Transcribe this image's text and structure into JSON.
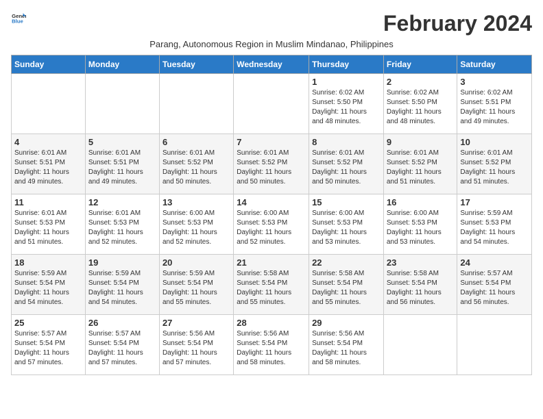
{
  "logo": {
    "text_general": "General",
    "text_blue": "Blue"
  },
  "title": "February 2024",
  "subtitle": "Parang, Autonomous Region in Muslim Mindanao, Philippines",
  "days_of_week": [
    "Sunday",
    "Monday",
    "Tuesday",
    "Wednesday",
    "Thursday",
    "Friday",
    "Saturday"
  ],
  "weeks": [
    [
      {
        "day": "",
        "info": ""
      },
      {
        "day": "",
        "info": ""
      },
      {
        "day": "",
        "info": ""
      },
      {
        "day": "",
        "info": ""
      },
      {
        "day": "1",
        "info": "Sunrise: 6:02 AM\nSunset: 5:50 PM\nDaylight: 11 hours\nand 48 minutes."
      },
      {
        "day": "2",
        "info": "Sunrise: 6:02 AM\nSunset: 5:50 PM\nDaylight: 11 hours\nand 48 minutes."
      },
      {
        "day": "3",
        "info": "Sunrise: 6:02 AM\nSunset: 5:51 PM\nDaylight: 11 hours\nand 49 minutes."
      }
    ],
    [
      {
        "day": "4",
        "info": "Sunrise: 6:01 AM\nSunset: 5:51 PM\nDaylight: 11 hours\nand 49 minutes."
      },
      {
        "day": "5",
        "info": "Sunrise: 6:01 AM\nSunset: 5:51 PM\nDaylight: 11 hours\nand 49 minutes."
      },
      {
        "day": "6",
        "info": "Sunrise: 6:01 AM\nSunset: 5:52 PM\nDaylight: 11 hours\nand 50 minutes."
      },
      {
        "day": "7",
        "info": "Sunrise: 6:01 AM\nSunset: 5:52 PM\nDaylight: 11 hours\nand 50 minutes."
      },
      {
        "day": "8",
        "info": "Sunrise: 6:01 AM\nSunset: 5:52 PM\nDaylight: 11 hours\nand 50 minutes."
      },
      {
        "day": "9",
        "info": "Sunrise: 6:01 AM\nSunset: 5:52 PM\nDaylight: 11 hours\nand 51 minutes."
      },
      {
        "day": "10",
        "info": "Sunrise: 6:01 AM\nSunset: 5:52 PM\nDaylight: 11 hours\nand 51 minutes."
      }
    ],
    [
      {
        "day": "11",
        "info": "Sunrise: 6:01 AM\nSunset: 5:53 PM\nDaylight: 11 hours\nand 51 minutes."
      },
      {
        "day": "12",
        "info": "Sunrise: 6:01 AM\nSunset: 5:53 PM\nDaylight: 11 hours\nand 52 minutes."
      },
      {
        "day": "13",
        "info": "Sunrise: 6:00 AM\nSunset: 5:53 PM\nDaylight: 11 hours\nand 52 minutes."
      },
      {
        "day": "14",
        "info": "Sunrise: 6:00 AM\nSunset: 5:53 PM\nDaylight: 11 hours\nand 52 minutes."
      },
      {
        "day": "15",
        "info": "Sunrise: 6:00 AM\nSunset: 5:53 PM\nDaylight: 11 hours\nand 53 minutes."
      },
      {
        "day": "16",
        "info": "Sunrise: 6:00 AM\nSunset: 5:53 PM\nDaylight: 11 hours\nand 53 minutes."
      },
      {
        "day": "17",
        "info": "Sunrise: 5:59 AM\nSunset: 5:53 PM\nDaylight: 11 hours\nand 54 minutes."
      }
    ],
    [
      {
        "day": "18",
        "info": "Sunrise: 5:59 AM\nSunset: 5:54 PM\nDaylight: 11 hours\nand 54 minutes."
      },
      {
        "day": "19",
        "info": "Sunrise: 5:59 AM\nSunset: 5:54 PM\nDaylight: 11 hours\nand 54 minutes."
      },
      {
        "day": "20",
        "info": "Sunrise: 5:59 AM\nSunset: 5:54 PM\nDaylight: 11 hours\nand 55 minutes."
      },
      {
        "day": "21",
        "info": "Sunrise: 5:58 AM\nSunset: 5:54 PM\nDaylight: 11 hours\nand 55 minutes."
      },
      {
        "day": "22",
        "info": "Sunrise: 5:58 AM\nSunset: 5:54 PM\nDaylight: 11 hours\nand 55 minutes."
      },
      {
        "day": "23",
        "info": "Sunrise: 5:58 AM\nSunset: 5:54 PM\nDaylight: 11 hours\nand 56 minutes."
      },
      {
        "day": "24",
        "info": "Sunrise: 5:57 AM\nSunset: 5:54 PM\nDaylight: 11 hours\nand 56 minutes."
      }
    ],
    [
      {
        "day": "25",
        "info": "Sunrise: 5:57 AM\nSunset: 5:54 PM\nDaylight: 11 hours\nand 57 minutes."
      },
      {
        "day": "26",
        "info": "Sunrise: 5:57 AM\nSunset: 5:54 PM\nDaylight: 11 hours\nand 57 minutes."
      },
      {
        "day": "27",
        "info": "Sunrise: 5:56 AM\nSunset: 5:54 PM\nDaylight: 11 hours\nand 57 minutes."
      },
      {
        "day": "28",
        "info": "Sunrise: 5:56 AM\nSunset: 5:54 PM\nDaylight: 11 hours\nand 58 minutes."
      },
      {
        "day": "29",
        "info": "Sunrise: 5:56 AM\nSunset: 5:54 PM\nDaylight: 11 hours\nand 58 minutes."
      },
      {
        "day": "",
        "info": ""
      },
      {
        "day": "",
        "info": ""
      }
    ]
  ]
}
